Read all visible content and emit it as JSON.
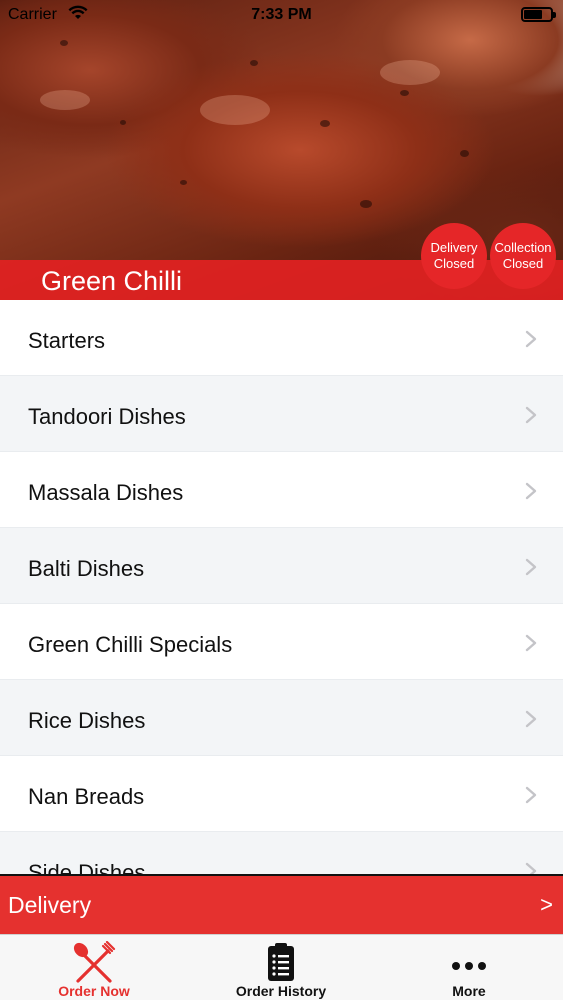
{
  "status_bar": {
    "carrier": "Carrier",
    "time": "7:33 PM"
  },
  "header": {
    "restaurant_name": "Green Chilli",
    "delivery_status": {
      "line1": "Delivery",
      "line2": "Closed"
    },
    "collection_status": {
      "line1": "Collection",
      "line2": "Closed"
    }
  },
  "menu": {
    "categories": [
      {
        "label": "Starters"
      },
      {
        "label": "Tandoori Dishes"
      },
      {
        "label": "Massala Dishes"
      },
      {
        "label": "Balti Dishes"
      },
      {
        "label": "Green Chilli Specials"
      },
      {
        "label": "Rice Dishes"
      },
      {
        "label": "Nan Breads"
      },
      {
        "label": "Side Dishes"
      }
    ]
  },
  "delivery_bar": {
    "label": "Delivery",
    "arrow": ">"
  },
  "tabbar": {
    "tabs": [
      {
        "label": "Order Now",
        "icon": "fork-knife-icon",
        "active": true
      },
      {
        "label": "Order History",
        "icon": "clipboard-list-icon",
        "active": false
      },
      {
        "label": "More",
        "icon": "more-dots-icon",
        "active": false
      }
    ]
  },
  "colors": {
    "accent": "#e5312f",
    "alt_row": "#f3f5f7",
    "tab_bg": "#f7f7f7"
  }
}
